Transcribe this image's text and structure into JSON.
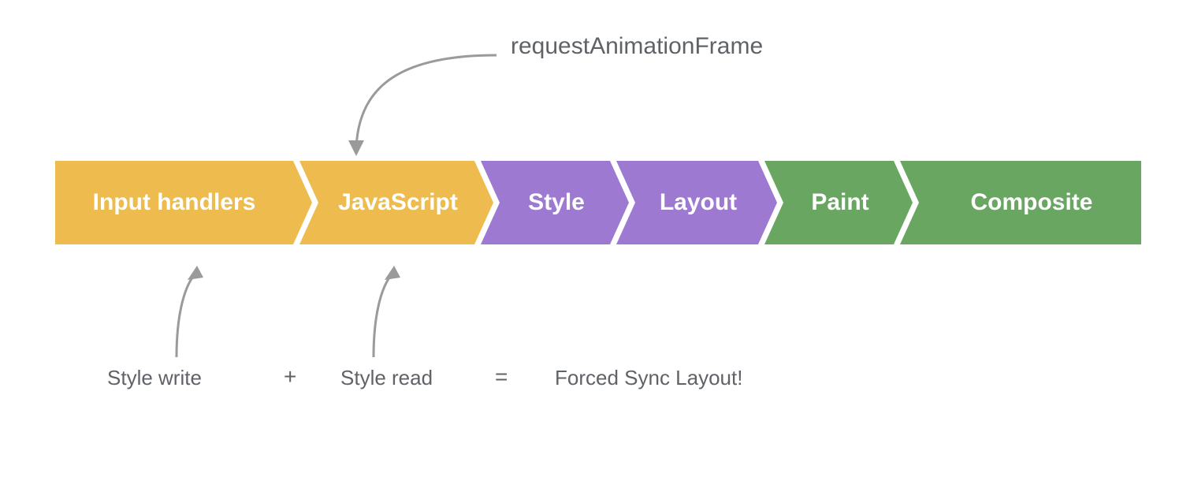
{
  "top_label": "requestAnimationFrame",
  "pipeline": {
    "input_handlers": "Input handlers",
    "javascript": "JavaScript",
    "style": "Style",
    "layout": "Layout",
    "paint": "Paint",
    "composite": "Composite"
  },
  "bottom": {
    "style_write": "Style write",
    "plus": "+",
    "style_read": "Style read",
    "equals": "=",
    "forced": "Forced Sync Layout!"
  },
  "colors": {
    "yellow": "#edbb4e",
    "purple": "#9d79d1",
    "green": "#68a662",
    "text": "#5f6368",
    "arrow": "#9a9a9a"
  }
}
